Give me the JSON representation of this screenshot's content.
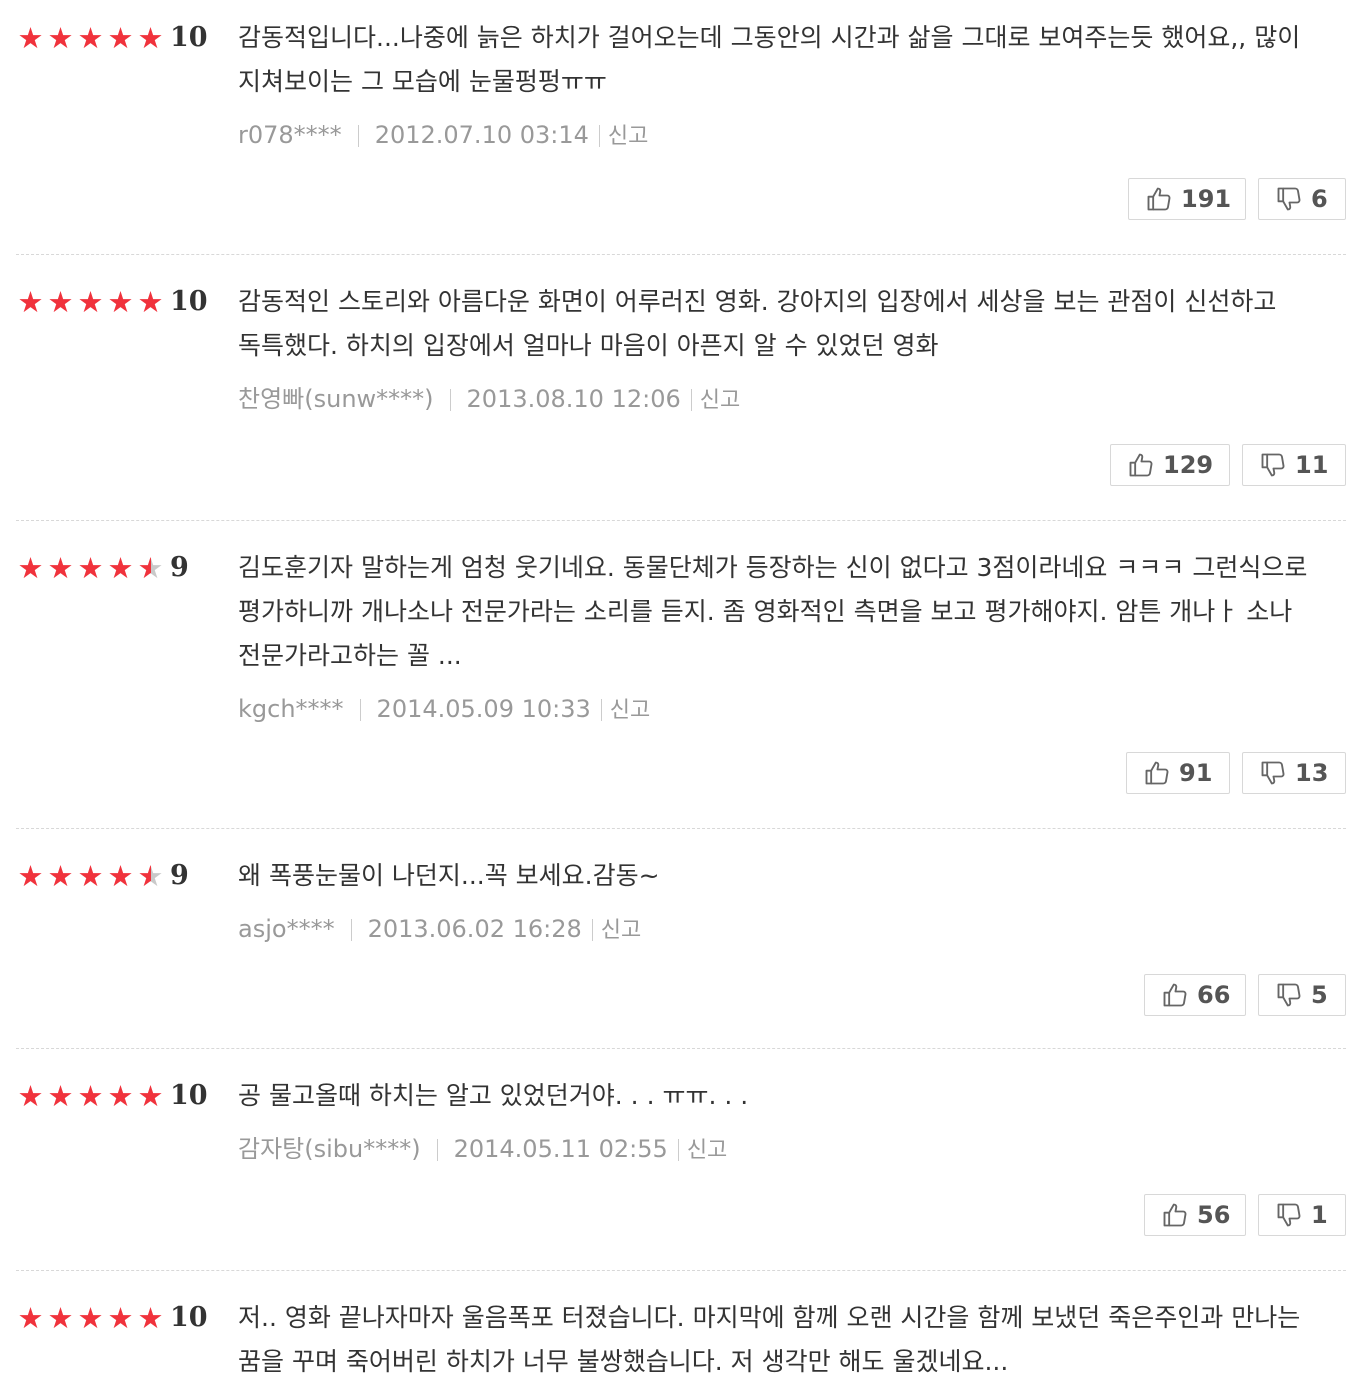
{
  "reviews": [
    {
      "stars": [
        "full",
        "full",
        "full",
        "full",
        "full"
      ],
      "score": "10",
      "text": "감동적입니다...나중에 늙은 하치가 걸어오는데 그동안의 시간과 삶을 그대로 보여주는듯 했어요,, 많이 지쳐보이는 그 모습에 눈물펑펑ㅠㅠ",
      "user": "r078****",
      "date": "2012.07.10 03:14",
      "report": "신고",
      "likes": "191",
      "dislikes": "6"
    },
    {
      "stars": [
        "full",
        "full",
        "full",
        "full",
        "full"
      ],
      "score": "10",
      "text": "감동적인 스토리와 아름다운 화면이 어루러진 영화. 강아지의 입장에서 세상을 보는 관점이 신선하고 독특했다. 하치의 입장에서 얼마나 마음이 아픈지 알 수 있었던 영화",
      "user": "찬영빠(sunw****)",
      "date": "2013.08.10 12:06",
      "report": "신고",
      "likes": "129",
      "dislikes": "11"
    },
    {
      "stars": [
        "full",
        "full",
        "full",
        "full",
        "half"
      ],
      "score": "9",
      "text": "김도훈기자 말하는게 엄청 웃기네요. 동물단체가 등장하는 신이 없다고 3점이라네요 ㅋㅋㅋ 그런식으로 평가하니까 개나소나 전문가라는 소리를 듣지. 좀 영화적인 측면을 보고 평가해야지. 암튼 개나ㅏ 소나 전문가라고하는 꼴 ...",
      "user": "kgch****",
      "date": "2014.05.09 10:33",
      "report": "신고",
      "likes": "91",
      "dislikes": "13"
    },
    {
      "stars": [
        "full",
        "full",
        "full",
        "full",
        "half"
      ],
      "score": "9",
      "text": "왜 폭풍눈물이 나던지...꼭 보세요.감동~",
      "user": "asjo****",
      "date": "2013.06.02 16:28",
      "report": "신고",
      "likes": "66",
      "dislikes": "5"
    },
    {
      "stars": [
        "full",
        "full",
        "full",
        "full",
        "full"
      ],
      "score": "10",
      "text": "공 물고올때 하치는 알고 있었던거야. . . ㅠㅠ. . .",
      "user": "감자탕(sibu****)",
      "date": "2014.05.11 02:55",
      "report": "신고",
      "likes": "56",
      "dislikes": "1"
    },
    {
      "stars": [
        "full",
        "full",
        "full",
        "full",
        "full"
      ],
      "score": "10",
      "text": "저.. 영화 끝나자마자 울음폭포 터졌습니다. 마지막에 함께 오랜 시간을 함께 보냈던 죽은주인과 만나는 꿈을 꾸며 죽어버린 하치가 너무 불쌍했습니다. 저 생각만 해도 울겠네요...",
      "user": "",
      "date": "",
      "report": "",
      "likes": "",
      "dislikes": ""
    }
  ]
}
